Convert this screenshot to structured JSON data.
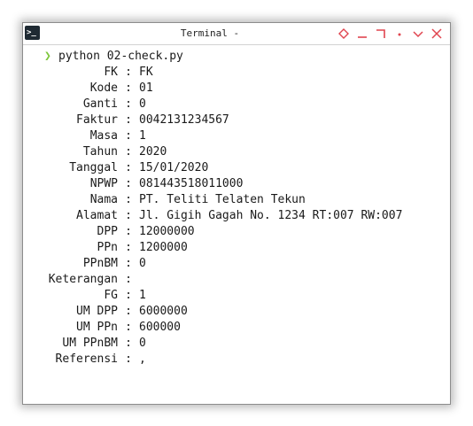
{
  "window": {
    "title": "Terminal -",
    "icon": "terminal-icon",
    "controls": [
      "diamond-icon",
      "minimize-icon",
      "maximize-icon",
      "dot-icon",
      "chevron-down-icon",
      "close-icon"
    ],
    "accent_color": "#e0454f"
  },
  "terminal": {
    "prompt_color": "#7cc63a",
    "command": "python 02-check.py",
    "separator": ":",
    "rows": [
      {
        "label": "FK",
        "value": "FK"
      },
      {
        "label": "Kode",
        "value": "01"
      },
      {
        "label": "Ganti",
        "value": "0"
      },
      {
        "label": "Faktur",
        "value": "0042131234567"
      },
      {
        "label": "Masa",
        "value": "1"
      },
      {
        "label": "Tahun",
        "value": "2020"
      },
      {
        "label": "Tanggal",
        "value": "15/01/2020"
      },
      {
        "label": "NPWP",
        "value": "081443518011000"
      },
      {
        "label": "Nama",
        "value": "PT. Teliti Telaten Tekun"
      },
      {
        "label": "Alamat",
        "value": "Jl. Gigih Gagah No. 1234 RT:007 RW:007"
      },
      {
        "label": "DPP",
        "value": "12000000"
      },
      {
        "label": "PPn",
        "value": "1200000"
      },
      {
        "label": "PPnBM",
        "value": "0"
      },
      {
        "label": "Keterangan",
        "value": ""
      },
      {
        "label": "FG",
        "value": "1"
      },
      {
        "label": "UM DPP",
        "value": "6000000"
      },
      {
        "label": "UM PPn",
        "value": "600000"
      },
      {
        "label": "UM PPnBM",
        "value": "0"
      },
      {
        "label": "Referensi",
        "value": ","
      }
    ]
  }
}
